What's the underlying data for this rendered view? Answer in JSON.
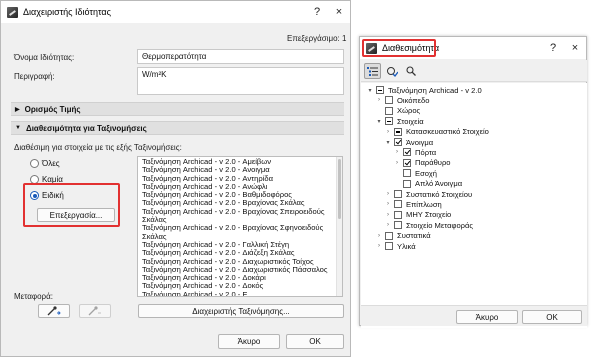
{
  "window_main": {
    "title": "Διαχειριστής Ιδιότητας",
    "help": "?",
    "close": "×",
    "selected_count": "Επεξεργάσιμο: 1",
    "property_name_label": "Όνομα Ιδιότητας:",
    "property_name_value": "Θερμοπερατότητα",
    "description_label": "Περιγραφή:",
    "description_value": "W/m²K",
    "section_value_def": "Ορισμός Τιμής",
    "section_availability": "Διαθεσιμότητα για Ταξινομήσεις",
    "availability_desc": "Διαθέσιμη για στοιχεία με τις εξής Ταξινομήσεις:",
    "radio_all": "Όλες",
    "radio_none": "Καμία",
    "radio_custom": "Ειδική",
    "edit_button": "Επεξεργασία...",
    "transfer_label": "Μεταφορά:",
    "manage_classifications_button": "Διαχειριστής Ταξινόμησης...",
    "cancel_button": "Άκυρο",
    "ok_button": "OK",
    "classification_list": [
      "Ταξινόμηση Archicad - v 2.0 - Αμείβων",
      "Ταξινόμηση Archicad - v 2.0 - Ανοιγμα",
      "Ταξινόμηση Archicad - v 2.0 - Αντηρίδα",
      "Ταξινόμηση Archicad - v 2.0 - Ανώφλι",
      "Ταξινόμηση Archicad - v 2.0 - Βαθμιδοφόρος",
      "Ταξινόμηση Archicad - v 2.0 - Βραχίονας Σκάλας",
      "Ταξινόμηση Archicad - v 2.0 - Βραχίονας Σπειροειδούς",
      "Σκάλας",
      "Ταξινόμηση Archicad - v 2.0 - Βραχίονας Σφηνοειδούς",
      "Σκάλας",
      "Ταξινόμηση Archicad - v 2.0 - Γαλλική Στέγη",
      "Ταξινόμηση Archicad - v 2.0 - Διάζεξη Σκάλας",
      "Ταξινόμηση Archicad - v 2.0 - Διαχωριστικός Τοίχος",
      "Ταξινόμηση Archicad - v 2.0 - Διαχωριστικός Πάσσαλος",
      "Ταξινόμηση Archicad - v 2.0 - Δοκάρι",
      "Ταξινόμηση Archicad - v 2.0 - Δοκός",
      "Ταξινόμηση Archicad - v 2.0 - Ε..."
    ]
  },
  "window_avail": {
    "title": "Διαθεσιμότητα",
    "help": "?",
    "close": "×",
    "tree": [
      {
        "label": "Ταξινόμηση Archicad - v 2.0",
        "expand": "▾",
        "check": "partial"
      },
      {
        "label": "Οικόπεδο",
        "expand": "›",
        "check": "none"
      },
      {
        "label": "Χώρος",
        "expand": "",
        "check": "none"
      },
      {
        "label": "Στοιχεία",
        "expand": "▾",
        "check": "partial"
      },
      {
        "label": "Κατασκευαστικό Στοιχείο",
        "expand": "›",
        "check": "partial"
      },
      {
        "label": "Άνοιγμα",
        "expand": "▾",
        "check": "checked"
      },
      {
        "label": "Πόρτα",
        "expand": "›",
        "check": "checked"
      },
      {
        "label": "Παράθυρο",
        "expand": "›",
        "check": "checked"
      },
      {
        "label": "Εσοχή",
        "expand": "",
        "check": "none"
      },
      {
        "label": "Απλό Άνοιγμα",
        "expand": "",
        "check": "none"
      },
      {
        "label": "Συστατικό Στοιχείου",
        "expand": "›",
        "check": "none"
      },
      {
        "label": "Επίπλωση",
        "expand": "›",
        "check": "none"
      },
      {
        "label": "ΜΗΥ Στοιχείο",
        "expand": "›",
        "check": "none"
      },
      {
        "label": "Στοιχείο Μεταφοράς",
        "expand": "›",
        "check": "none"
      },
      {
        "label": "Συστατικά",
        "expand": "›",
        "check": "none"
      },
      {
        "label": "Υλικά",
        "expand": "›",
        "check": "none"
      }
    ],
    "cancel_button": "Άκυρο",
    "ok_button": "OK"
  }
}
